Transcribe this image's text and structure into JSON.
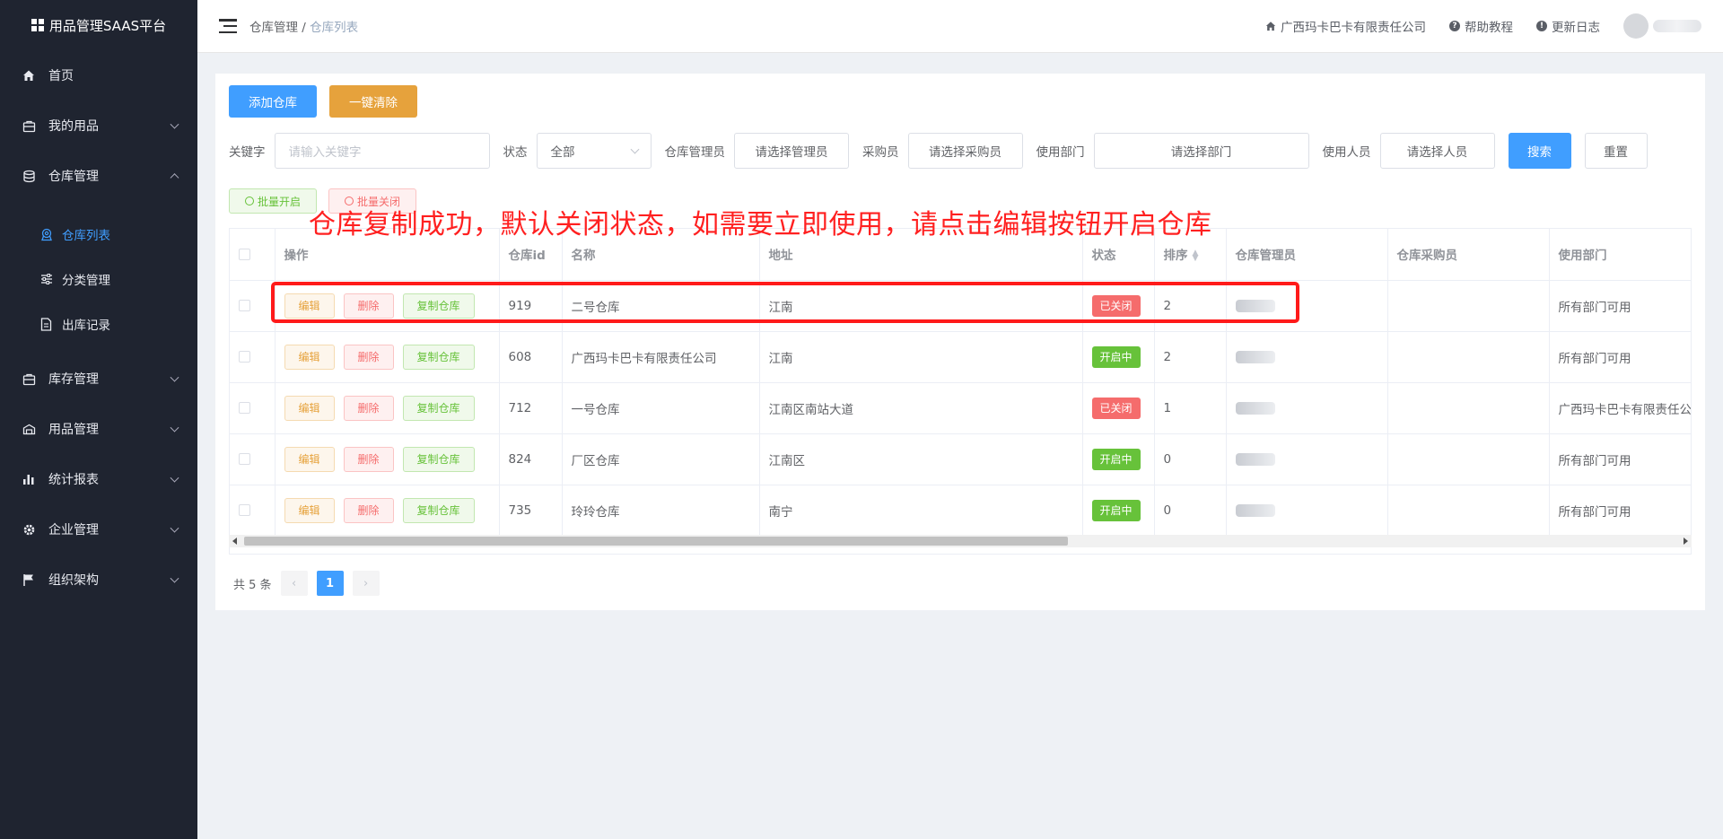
{
  "app": {
    "title": "用品管理SAAS平台"
  },
  "sidebar": {
    "items": [
      {
        "label": "首页",
        "icon": "home-icon"
      },
      {
        "label": "我的用品",
        "icon": "bag-icon"
      },
      {
        "label": "仓库管理",
        "icon": "database-icon",
        "expanded": true,
        "children": [
          {
            "label": "仓库列表",
            "icon": "location-icon",
            "active": true
          },
          {
            "label": "分类管理",
            "icon": "sliders-icon"
          },
          {
            "label": "出库记录",
            "icon": "document-icon"
          }
        ]
      },
      {
        "label": "库存管理",
        "icon": "bag-icon"
      },
      {
        "label": "用品管理",
        "icon": "box-icon"
      },
      {
        "label": "统计报表",
        "icon": "bar-chart-icon"
      },
      {
        "label": "企业管理",
        "icon": "gear-icon"
      },
      {
        "label": "组织架构",
        "icon": "flag-icon"
      }
    ]
  },
  "header": {
    "breadcrumb": {
      "parent": "仓库管理",
      "separator": "/",
      "current": "仓库列表"
    },
    "company": "广西玛卡巴卡有限责任公司",
    "help": "帮助教程",
    "changelog": "更新日志"
  },
  "toolbar": {
    "add_label": "添加仓库",
    "clear_label": "一键清除"
  },
  "filters": {
    "keyword_label": "关键字",
    "keyword_placeholder": "请输入关键字",
    "status_label": "状态",
    "status_value": "全部",
    "manager_label": "仓库管理员",
    "manager_placeholder": "请选择管理员",
    "buyer_label": "采购员",
    "buyer_placeholder": "请选择采购员",
    "dept_label": "使用部门",
    "dept_placeholder": "请选择部门",
    "user_label": "使用人员",
    "user_placeholder": "请选择人员",
    "search_label": "搜索",
    "reset_label": "重置"
  },
  "batch": {
    "open_label": "批量开启",
    "close_label": "批量关闭"
  },
  "annotation": "仓库复制成功，默认关闭状态，如需要立即使用，请点击编辑按钮开启仓库",
  "table": {
    "columns": [
      "操作",
      "仓库id",
      "名称",
      "地址",
      "状态",
      "排序",
      "仓库管理员",
      "仓库采购员",
      "使用部门"
    ],
    "actions": {
      "edit": "编辑",
      "delete": "删除",
      "copy": "复制仓库"
    },
    "rows": [
      {
        "id": "919",
        "name": "二号仓库",
        "address": "江南",
        "status": "已关闭",
        "status_type": "closed",
        "sort": "2",
        "manager_visible": "",
        "buyer": "",
        "dept": "所有部门可用"
      },
      {
        "id": "608",
        "name": "广西玛卡巴卡有限责任公司",
        "address": "江南",
        "status": "开启中",
        "status_type": "open",
        "sort": "2",
        "manager_visible": "",
        "buyer": "",
        "dept": "所有部门可用"
      },
      {
        "id": "712",
        "name": "一号仓库",
        "address": "江南区南站大道",
        "status": "已关闭",
        "status_type": "closed",
        "sort": "1",
        "manager_visible": "",
        "buyer": "",
        "dept": "广西玛卡巴卡有限责任公"
      },
      {
        "id": "824",
        "name": "厂区仓库",
        "address": "江南区",
        "status": "开启中",
        "status_type": "open",
        "sort": "0",
        "manager_visible": "",
        "buyer": "",
        "dept": "所有部门可用"
      },
      {
        "id": "735",
        "name": "玲玲仓库",
        "address": "南宁",
        "status": "开启中",
        "status_type": "open",
        "sort": "0",
        "manager_visible": "",
        "buyer": "",
        "dept": "所有部门可用"
      }
    ]
  },
  "pagination": {
    "total_label": "共 5 条",
    "current_page": "1"
  },
  "colors": {
    "primary": "#409eff",
    "warning": "#e6a23c",
    "success": "#67c23a",
    "danger": "#f56c6c",
    "annotation": "#ff2020",
    "sidebar_bg": "#1f2430"
  }
}
